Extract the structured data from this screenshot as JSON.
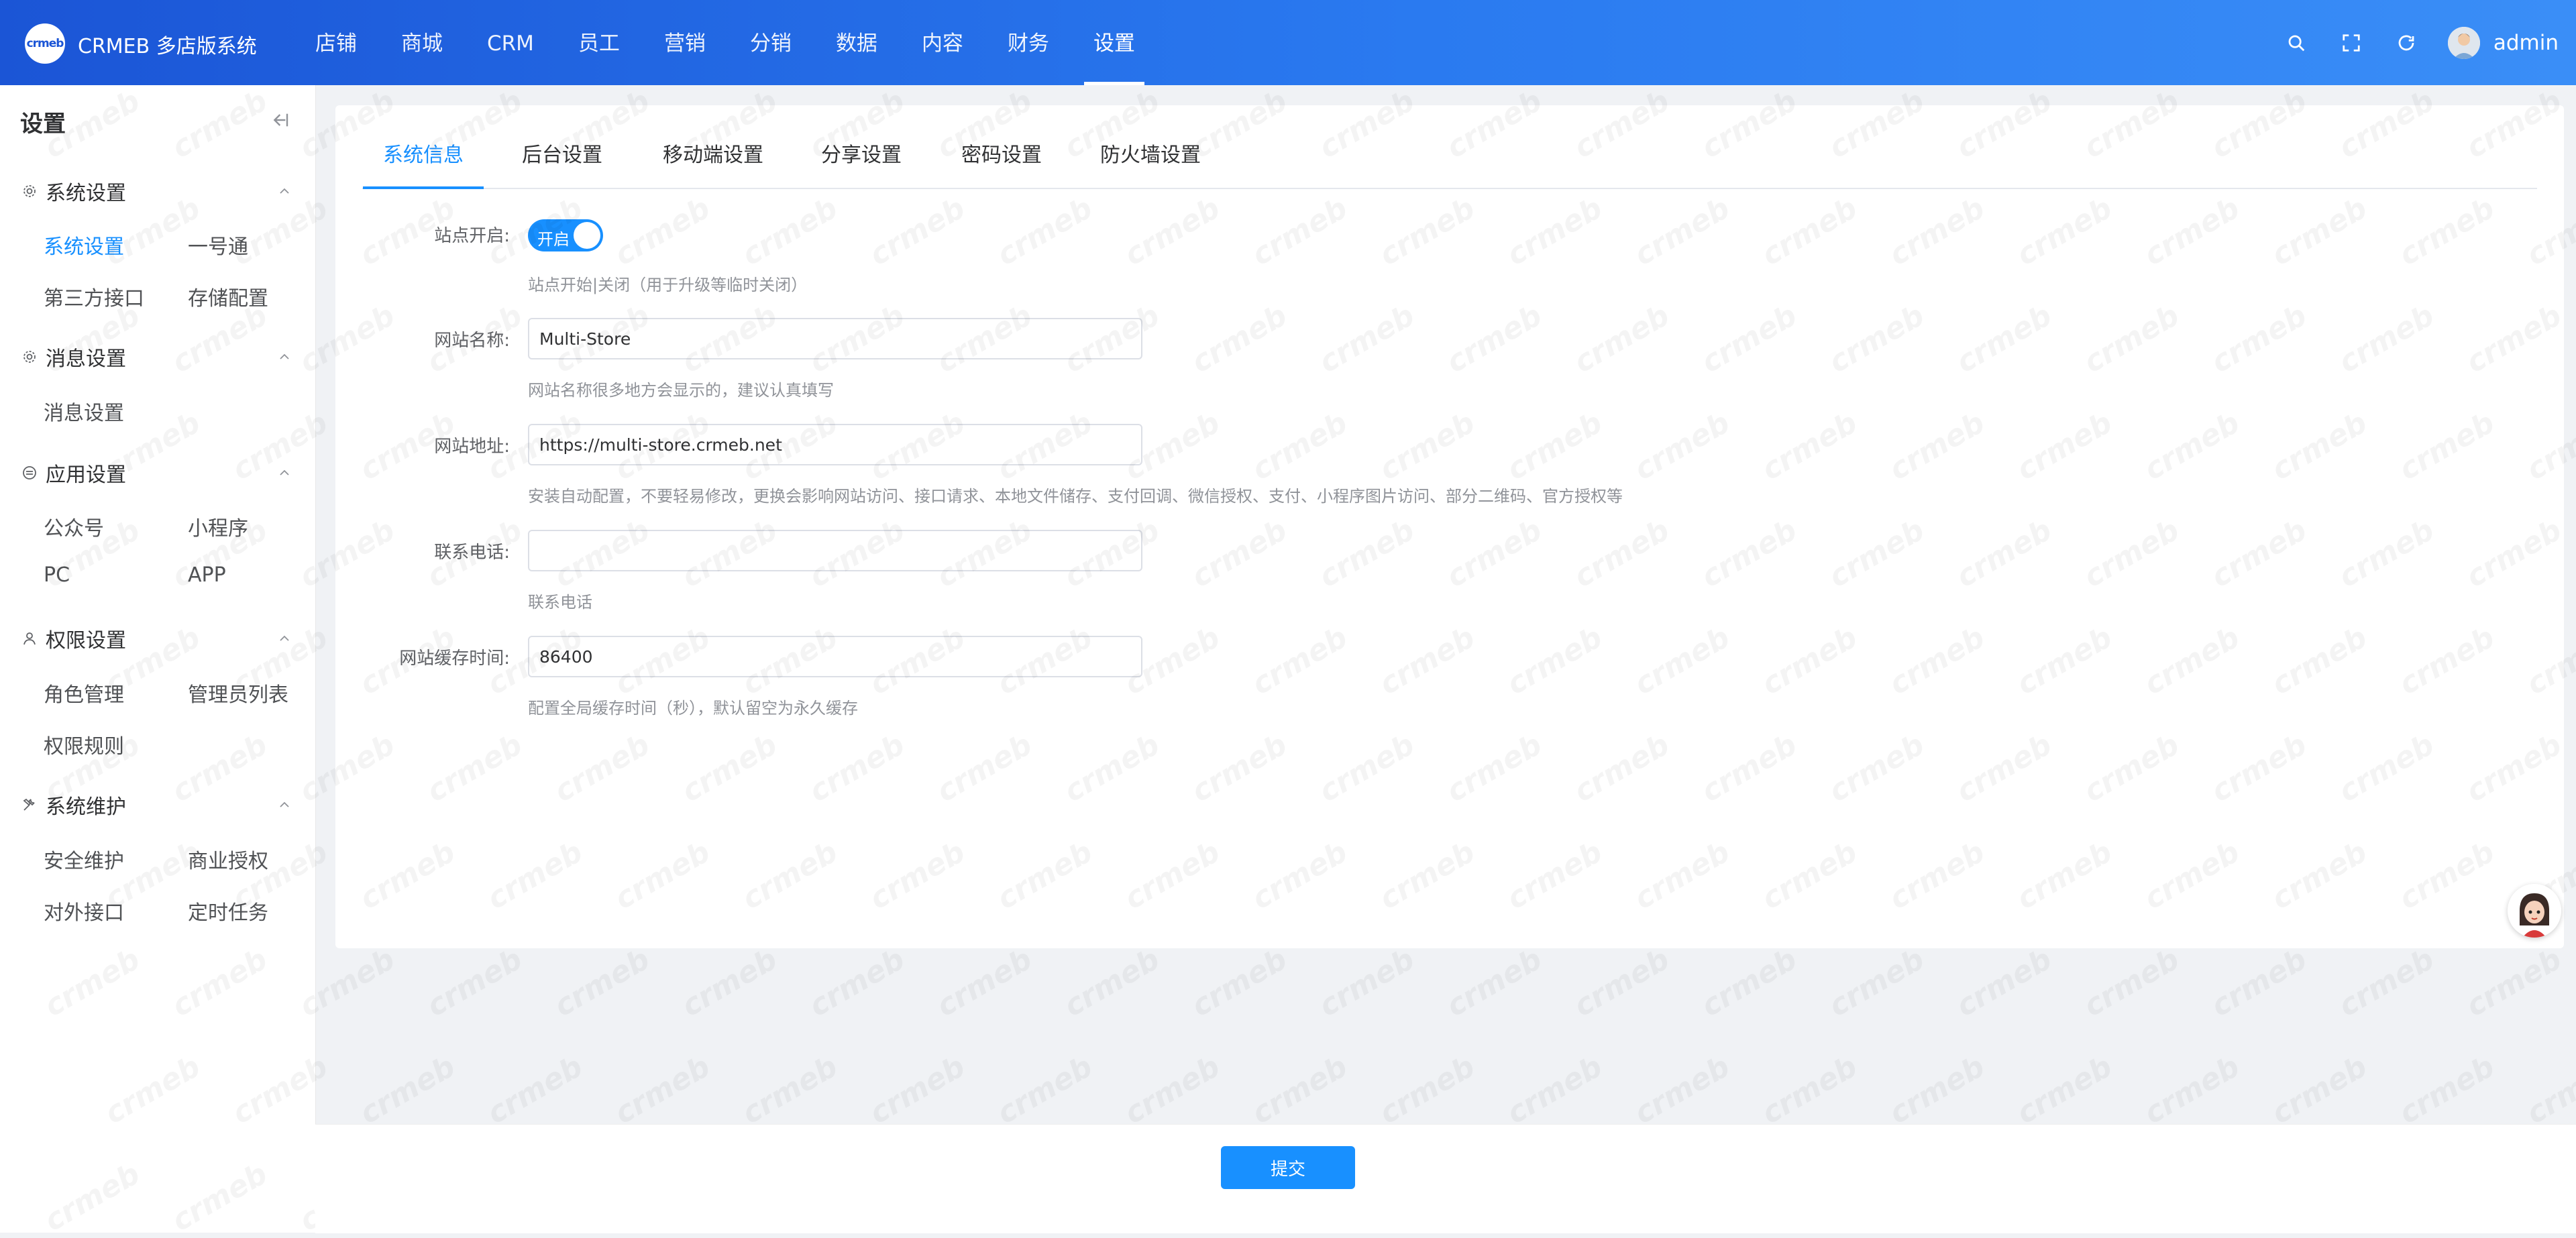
{
  "header": {
    "logo_text": "crmeb",
    "title": "CRMEB 多店版系统",
    "nav": [
      "店铺",
      "商城",
      "CRM",
      "员工",
      "营销",
      "分销",
      "数据",
      "内容",
      "财务",
      "设置"
    ],
    "active_nav": "设置",
    "username": "admin",
    "tool_icons": [
      "search-icon",
      "fullscreen-icon",
      "refresh-icon"
    ]
  },
  "sidebar": {
    "title": "设置",
    "groups": [
      {
        "label": "系统设置",
        "icon": "gear-icon",
        "items": [
          "系统设置",
          "一号通",
          "第三方接口",
          "存储配置"
        ]
      },
      {
        "label": "消息设置",
        "icon": "gear-icon",
        "items": [
          "消息设置"
        ]
      },
      {
        "label": "应用设置",
        "icon": "app-icon",
        "items": [
          "公众号",
          "小程序",
          "PC",
          "APP"
        ]
      },
      {
        "label": "权限设置",
        "icon": "user-icon",
        "items": [
          "角色管理",
          "管理员列表",
          "权限规则"
        ]
      },
      {
        "label": "系统维护",
        "icon": "tools-icon",
        "items": [
          "安全维护",
          "商业授权",
          "对外接口",
          "定时任务"
        ]
      }
    ],
    "active_item": "系统设置"
  },
  "tabs": [
    "系统信息",
    "后台设置",
    "移动端设置",
    "分享设置",
    "密码设置",
    "防火墙设置"
  ],
  "active_tab": "系统信息",
  "form": {
    "site_open": {
      "label": "站点开启:",
      "switch_text": "开启",
      "on": true,
      "tip": "站点开始|关闭（用于升级等临时关闭）"
    },
    "site_name": {
      "label": "网站名称:",
      "value": "Multi-Store",
      "tip": "网站名称很多地方会显示的，建议认真填写"
    },
    "site_url": {
      "label": "网站地址:",
      "value": "https://multi-store.crmeb.net",
      "tip": "安装自动配置，不要轻易修改，更换会影响网站访问、接口请求、本地文件储存、支付回调、微信授权、支付、小程序图片访问、部分二维码、官方授权等"
    },
    "phone": {
      "label": "联系电话:",
      "value": "",
      "tip": "联系电话"
    },
    "cache_time": {
      "label": "网站缓存时间:",
      "value": "86400",
      "tip": "配置全局缓存时间（秒），默认留空为永久缓存"
    }
  },
  "footer": {
    "submit_label": "提交"
  },
  "watermark_text": "crmeb",
  "colors": {
    "primary": "#1890ff",
    "header_start": "#1b55d6",
    "header_end": "#3a8ef7"
  }
}
